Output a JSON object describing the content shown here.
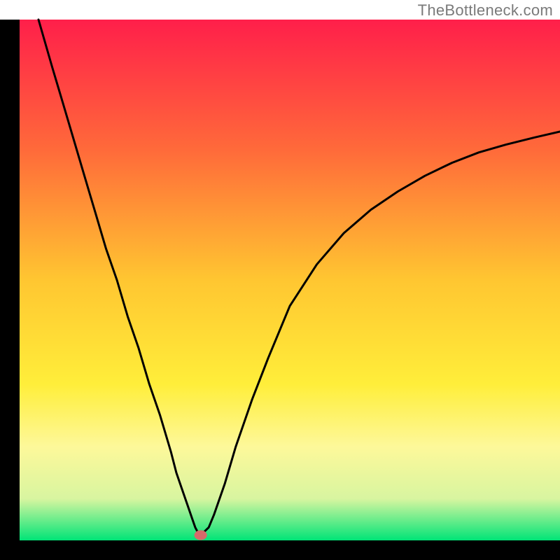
{
  "watermark": "TheBottleneck.com",
  "chart_data": {
    "type": "line",
    "title": "",
    "xlabel": "",
    "ylabel": "",
    "xlim": [
      0,
      100
    ],
    "ylim": [
      0,
      100
    ],
    "grid": false,
    "legend": false,
    "background_gradient": {
      "type": "vertical",
      "stops": [
        {
          "pos": 0.0,
          "color": "#ff1f4a"
        },
        {
          "pos": 0.25,
          "color": "#ff6a3a"
        },
        {
          "pos": 0.5,
          "color": "#ffc631"
        },
        {
          "pos": 0.7,
          "color": "#ffee3a"
        },
        {
          "pos": 0.82,
          "color": "#fdf89a"
        },
        {
          "pos": 0.92,
          "color": "#d8f5a0"
        },
        {
          "pos": 1.0,
          "color": "#00e477"
        }
      ]
    },
    "series": [
      {
        "name": "bottleneck-curve",
        "x": [
          3.5,
          6,
          8,
          10,
          12,
          14,
          16,
          18,
          20,
          22,
          24,
          26,
          28,
          29,
          30,
          31,
          32,
          32.5,
          33,
          33.5,
          34,
          35,
          36,
          38,
          40,
          43,
          46,
          50,
          55,
          60,
          65,
          70,
          75,
          80,
          85,
          90,
          95,
          100
        ],
        "y": [
          100,
          91,
          84,
          77,
          70,
          63,
          56,
          50,
          43,
          37,
          30,
          24,
          17,
          13,
          10,
          7,
          4,
          2.5,
          1.5,
          1,
          1.5,
          2.5,
          5,
          11,
          18,
          27,
          35,
          45,
          53,
          59,
          63.5,
          67,
          70,
          72.5,
          74.5,
          76,
          77.3,
          78.5
        ]
      }
    ],
    "marker": {
      "x": 33.5,
      "y": 1,
      "color": "#d66a6a",
      "radius": 7
    },
    "frame": {
      "color": "#000000",
      "width": 3
    },
    "curve_stroke": {
      "color": "#000000",
      "width": 3
    }
  }
}
